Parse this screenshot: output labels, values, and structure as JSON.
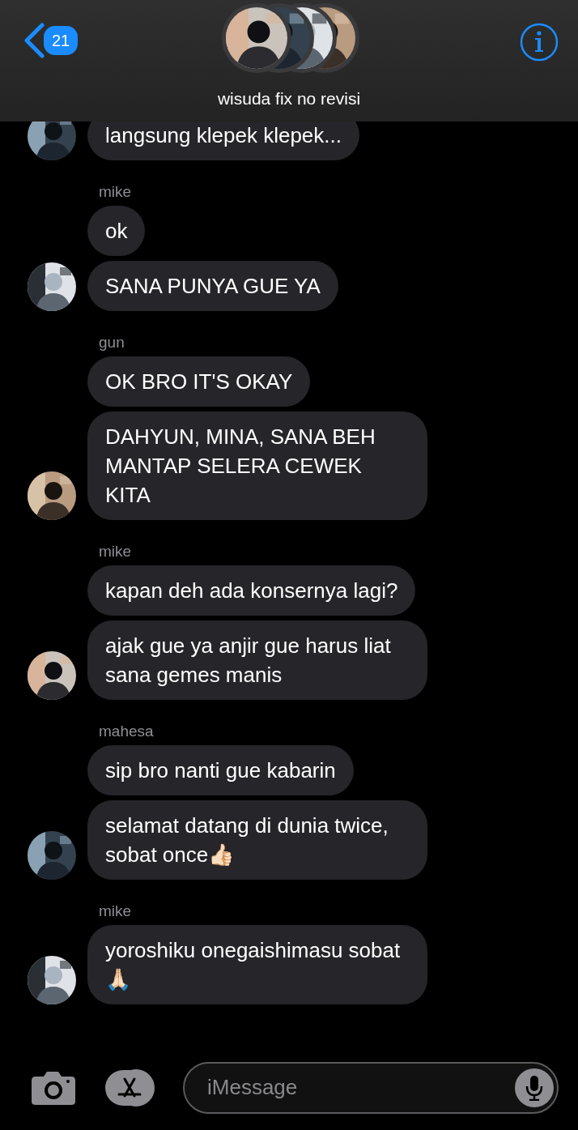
{
  "header": {
    "back_count": "21",
    "title": "wisuda fix no revisi"
  },
  "groups": [
    {
      "messages": [
        {
          "text": "langsung klepek klepek..."
        }
      ]
    },
    {
      "sender": "mike",
      "messages": [
        {
          "text": "ok"
        },
        {
          "text": "SANA PUNYA GUE YA"
        }
      ]
    },
    {
      "sender": "gun",
      "messages": [
        {
          "text": "OK BRO IT'S OKAY"
        },
        {
          "text": "DAHYUN, MINA, SANA BEH MANTAP SELERA CEWEK KITA"
        }
      ]
    },
    {
      "sender": "mike",
      "messages": [
        {
          "text": "kapan deh ada konsernya lagi?"
        },
        {
          "text": "ajak gue ya anjir gue harus liat sana gemes manis"
        }
      ]
    },
    {
      "sender": "mahesa",
      "messages": [
        {
          "text": "sip bro nanti gue kabarin"
        },
        {
          "text": "selamat datang di dunia twice, sobat once👍🏻"
        }
      ]
    },
    {
      "sender": "mike",
      "messages": [
        {
          "text": "yoroshiku onegaishimasu sobat🙏🏻"
        }
      ]
    }
  ],
  "composer": {
    "placeholder": "iMessage"
  }
}
